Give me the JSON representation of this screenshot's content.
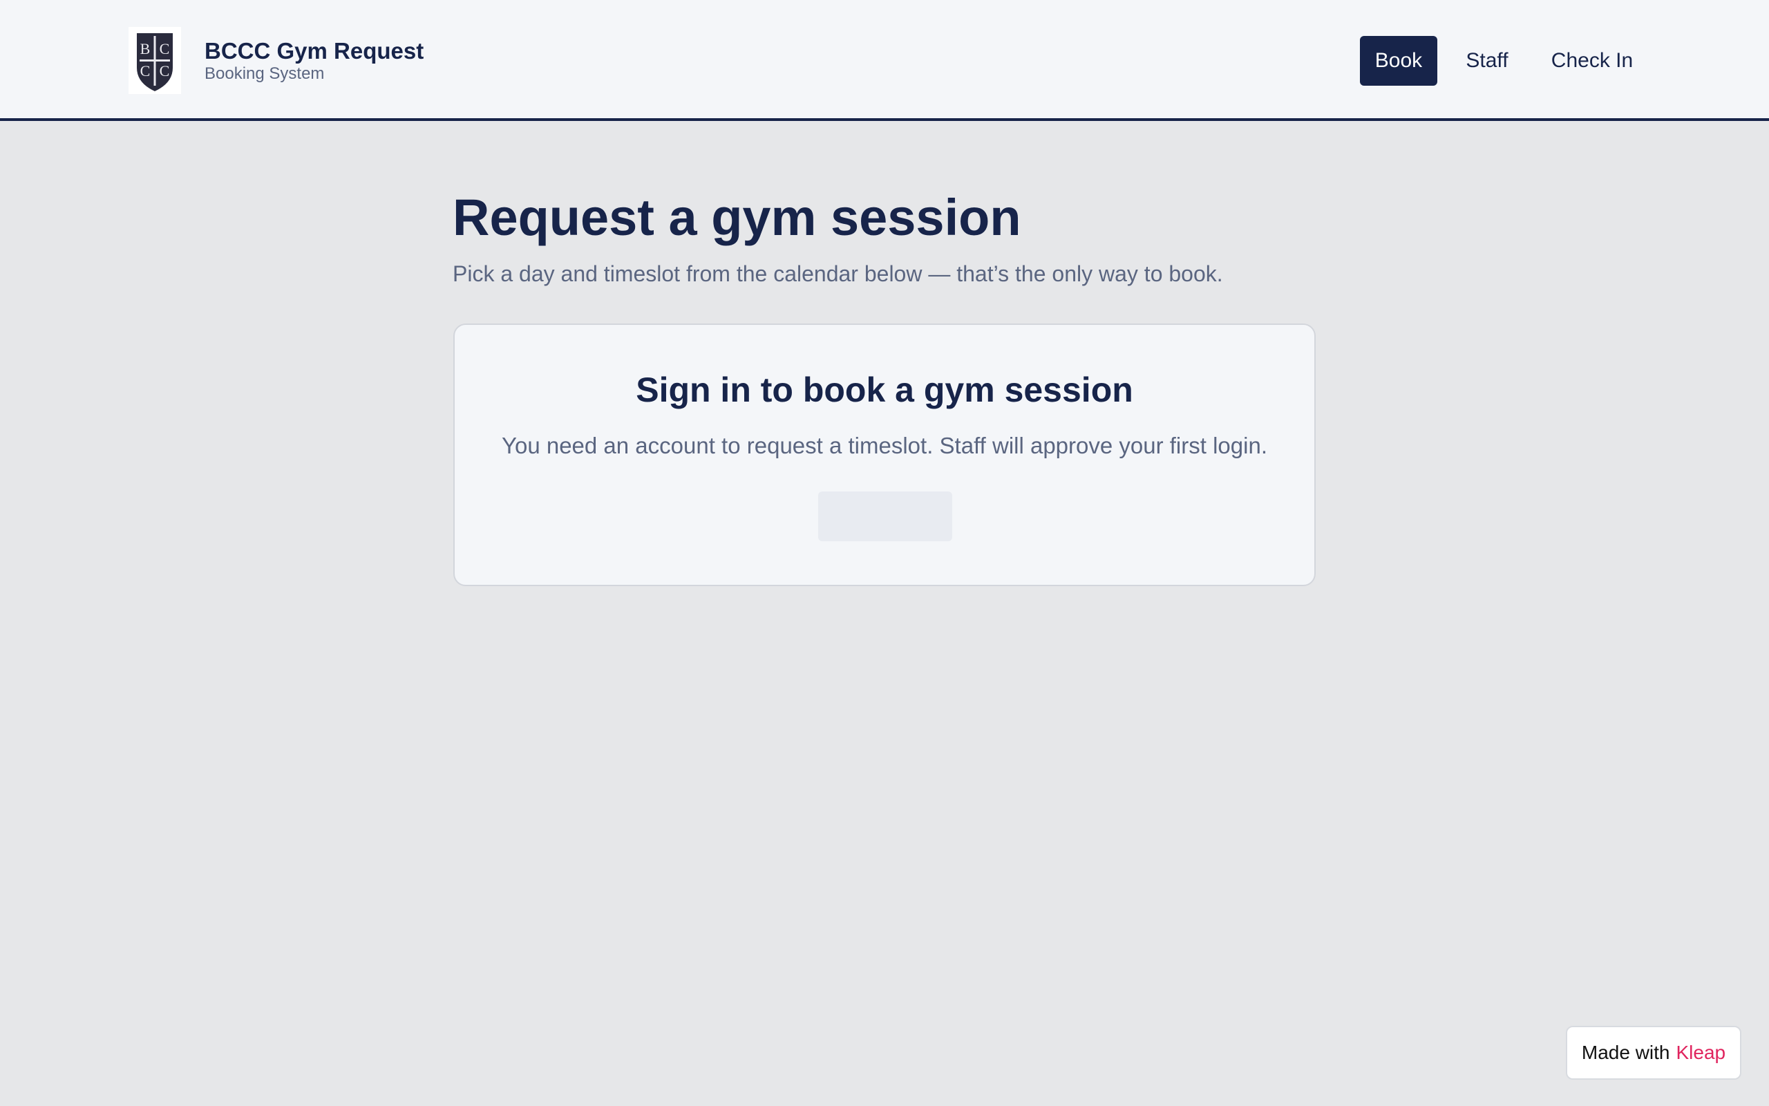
{
  "header": {
    "title": "BCCC Gym Request",
    "subtitle": "Booking System",
    "logo_icon": "shield-crest-icon",
    "logo_letters": [
      "B",
      "C",
      "C",
      "C"
    ],
    "nav": {
      "book": "Book",
      "staff": "Staff",
      "check_in": "Check In"
    }
  },
  "main": {
    "title": "Request a gym session",
    "subtitle": "Pick a day and timeslot from the calendar below — that’s the only way to book.",
    "card": {
      "title": "Sign in to book a gym session",
      "text": "You need an account to request a timeslot. Staff will approve your first login."
    }
  },
  "badge": {
    "prefix": "Made with",
    "brand": "Kleap"
  },
  "colors": {
    "primary": "#17244a",
    "muted_text": "#5a6580",
    "page_bg": "#e6e7e9",
    "surface": "#f4f6f9",
    "accent_pink": "#e0245e"
  }
}
